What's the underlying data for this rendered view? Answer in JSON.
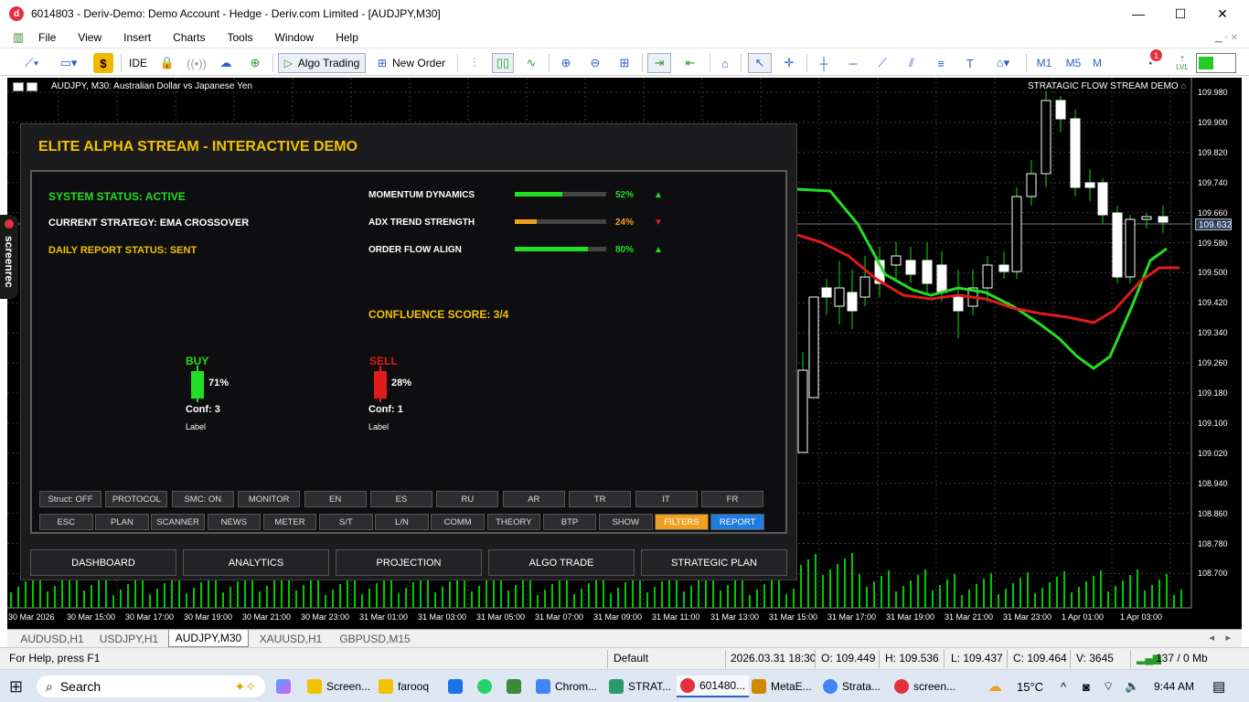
{
  "window": {
    "title": "6014803 - Deriv-Demo: Demo Account - Hedge - Deriv.com Limited - [AUDJPY,M30]",
    "app_icon": "d",
    "controls": {
      "minimize": "—",
      "maximize": "☐",
      "close": "✕"
    }
  },
  "menu": {
    "items": [
      "File",
      "View",
      "Insert",
      "Charts",
      "Tools",
      "Window",
      "Help"
    ]
  },
  "toolbar": {
    "ide_label": "IDE",
    "algo_trading_label": "Algo Trading",
    "new_order_label": "New Order",
    "tf_m1": "M1",
    "tf_m5": "M5",
    "tf_m": "M",
    "notification_count": "1",
    "signal_label": "LVL"
  },
  "chart": {
    "title": "AUDJPY, M30:  Australian Dollar vs Japanese Yen",
    "stream_label": "STRATAGIC FLOW STREAM DEMO",
    "current_price": "109.632",
    "price_labels": [
      "109.980",
      "109.900",
      "109.820",
      "109.740",
      "109.660",
      "109.580",
      "109.500",
      "109.420",
      "109.340",
      "109.260",
      "109.180",
      "109.100",
      "109.020",
      "108.940",
      "108.860",
      "108.780",
      "108.700"
    ],
    "time_labels": [
      "30 Mar 2026",
      "30 Mar 15:00",
      "30 Mar 17:00",
      "30 Mar 19:00",
      "30 Mar 21:00",
      "30 Mar 23:00",
      "31 Mar 01:00",
      "31 Mar 03:00",
      "31 Mar 05:00",
      "31 Mar 07:00",
      "31 Mar 09:00",
      "31 Mar 11:00",
      "31 Mar 13:00",
      "31 Mar 15:00",
      "31 Mar 17:00",
      "31 Mar 19:00",
      "31 Mar 21:00",
      "31 Mar 23:00",
      "1 Apr 01:00",
      "1 Apr 03:00"
    ],
    "colors": {
      "bull": "#ffffff",
      "bear": "#ffffff",
      "wick": "#00e000",
      "ema_fast": "#22dd22",
      "ema_slow": "#e01b1b",
      "grid": "#3a3a3a",
      "volume": "#00c800"
    }
  },
  "screenrec": {
    "label": "screenrec"
  },
  "panel": {
    "title": "ELITE ALPHA STREAM - INTERACTIVE DEMO",
    "system_status": "SYSTEM STATUS: ACTIVE",
    "current_strategy": "CURRENT STRATEGY: EMA CROSSOVER",
    "daily_report": "DAILY REPORT STATUS: SENT",
    "meters": [
      {
        "label": "MOMENTUM DYNAMICS",
        "value": 52,
        "pct": "52%",
        "color": "#22dd22",
        "arrow": "▲",
        "arrow_color": "#22dd22"
      },
      {
        "label": "ADX TREND STRENGTH",
        "value": 24,
        "pct": "24%",
        "color": "#f0a020",
        "arrow": "▼",
        "arrow_color": "#e01b1b"
      },
      {
        "label": "ORDER FLOW ALIGN",
        "value": 80,
        "pct": "80%",
        "color": "#22dd22",
        "arrow": "▲",
        "arrow_color": "#22dd22"
      }
    ],
    "confluence": "CONFLUENCE SCORE: 3/4",
    "buy": {
      "title": "BUY",
      "pct": "71%",
      "conf": "Conf: 3",
      "label": "Label"
    },
    "sell": {
      "title": "SELL",
      "pct": "28%",
      "conf": "Conf: 1",
      "label": "Label"
    },
    "grid_row1": [
      "Struct: OFF",
      "PROTOCOL",
      "SMC: ON",
      "MONITOR",
      "EN",
      "ES",
      "RU",
      "AR",
      "TR",
      "IT",
      "FR"
    ],
    "grid_row2": [
      "ESC",
      "PLAN",
      "SCANNER",
      "NEWS",
      "METER",
      "S/T",
      "L/N",
      "COMM",
      "THEORY",
      "BTP",
      "SHOW",
      "FILTERS",
      "REPORT"
    ],
    "bottom_buttons": [
      "DASHBOARD",
      "ANALYTICS",
      "PROJECTION",
      "ALGO TRADE",
      "STRATEGIC PLAN"
    ]
  },
  "symbol_tabs": [
    "AUDUSD,H1",
    "USDJPY,H1",
    "AUDJPY,M30",
    "XAUUSD,H1",
    "GBPUSD,M15"
  ],
  "status": {
    "help": "For Help, press F1",
    "profile": "Default",
    "datetime": "2026.03.31 18:30",
    "open": "O: 109.449",
    "high": "H: 109.536",
    "low": "L: 109.437",
    "close": "C: 109.464",
    "volume": "V: 3645",
    "traffic": "137 / 0 Mb"
  },
  "taskbar": {
    "search": "Search",
    "apps": [
      "Screen...",
      "farooq",
      "Chrom...",
      "STRAT...",
      "601480...",
      "MetaE...",
      "Strata...",
      "screen..."
    ],
    "temperature": "15°C",
    "time": "9:44 AM"
  }
}
